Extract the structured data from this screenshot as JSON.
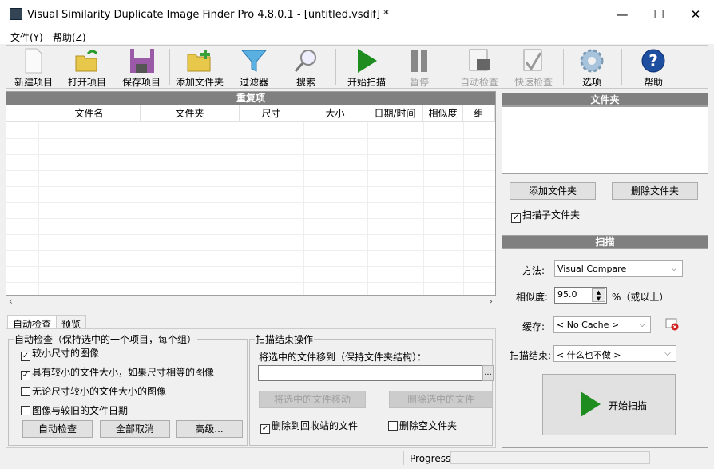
{
  "window": {
    "title": "Visual Similarity Duplicate Image Finder Pro 4.8.0.1 - [untitled.vsdif] *",
    "minimize": "—",
    "maximize": "☐",
    "close": "✕"
  },
  "menu": [
    "文件(Y)",
    "帮助(Z)"
  ],
  "toolbar": [
    {
      "label": "新建项目",
      "icon": "new-file-icon",
      "enabled": true
    },
    {
      "label": "打开项目",
      "icon": "open-folder-icon",
      "enabled": true
    },
    {
      "label": "保存项目",
      "icon": "save-disk-icon",
      "enabled": true
    },
    {
      "label": "添加文件夹",
      "icon": "add-folder-icon",
      "enabled": true
    },
    {
      "label": "过滤器",
      "icon": "filter-icon",
      "enabled": true
    },
    {
      "label": "搜索",
      "icon": "search-icon",
      "enabled": true
    },
    {
      "label": "开始扫描",
      "icon": "play-icon",
      "enabled": true
    },
    {
      "label": "暂停",
      "icon": "pause-icon",
      "enabled": false
    },
    {
      "label": "自动检查",
      "icon": "auto-check-icon",
      "enabled": false
    },
    {
      "label": "快速检查",
      "icon": "quick-check-icon",
      "enabled": false
    },
    {
      "label": "选项",
      "icon": "gear-icon",
      "enabled": true
    },
    {
      "label": "帮助",
      "icon": "help-icon",
      "enabled": true
    }
  ],
  "duplicates": {
    "title": "重复项",
    "columns": [
      "",
      "文件名",
      "文件夹",
      "尺寸",
      "大小",
      "日期/时间",
      "相似度",
      "组"
    ]
  },
  "tabs": [
    "自动检查",
    "预览"
  ],
  "autocheck": {
    "legend": "自动检查（保持选中的一个项目，每个组）",
    "options": [
      {
        "label": "较小尺寸的图像",
        "checked": true
      },
      {
        "label": "具有较小的文件大小，如果尺寸相等的图像",
        "checked": true
      },
      {
        "label": "无论尺寸较小的文件大小的图像",
        "checked": false
      },
      {
        "label": "图像与较旧的文件日期",
        "checked": false
      }
    ],
    "buttons": [
      "自动检查",
      "全部取消",
      "高级..."
    ]
  },
  "endscan": {
    "legend": "扫描结束操作",
    "move_label": "将选中的文件移到（保持文件夹结构）：",
    "move_path": "",
    "browse": "...",
    "move_btn": "将选中的文件移动",
    "delete_btn": "删除选中的文件",
    "recycle": {
      "label": "删除到回收站的文件",
      "checked": true
    },
    "empty": {
      "label": "删除空文件夹",
      "checked": false
    }
  },
  "folders": {
    "title": "文件夹",
    "add": "添加文件夹",
    "remove": "删除文件夹",
    "subfolders": {
      "label": "扫描子文件夹",
      "checked": true
    }
  },
  "scan": {
    "title": "扫描",
    "method_label": "方法:",
    "method": "Visual Compare",
    "similarity_label": "相似度:",
    "similarity": "95.0",
    "similarity_suffix": "%（或以上）",
    "cache_label": "缓存:",
    "cache": "< No Cache >",
    "end_label": "扫描结束:",
    "end": "< 什么也不做 >",
    "start": "开始扫描"
  },
  "status": {
    "progress": "Progress"
  },
  "colors": {
    "header": "#808080",
    "play": "#1e8c1e"
  }
}
